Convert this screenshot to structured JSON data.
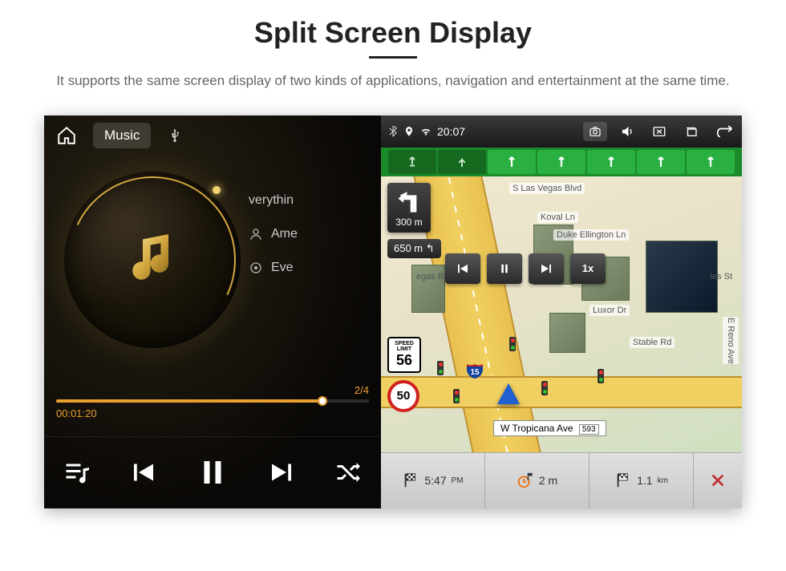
{
  "page": {
    "title": "Split Screen Display",
    "description": "It supports the same screen display of two kinds of applications, navigation and entertainment at the same time."
  },
  "music": {
    "tabs": {
      "music": "Music"
    },
    "track_title_partial": "verythin",
    "artist_partial": "Ame",
    "album_partial": "Eve",
    "counter": "2/4",
    "elapsed": "00:01:20"
  },
  "nav": {
    "status_time": "20:07",
    "turn": {
      "distance": "300 m"
    },
    "next_turn_distance": "650 m",
    "speed_limit": {
      "label_top": "SPEED",
      "label_mid": "LIMIT",
      "value": "56"
    },
    "current_speed": "50",
    "playback_speed": "1x",
    "streets": {
      "las_vegas": "S Las Vegas Blvd",
      "koval": "Koval Ln",
      "duke": "Duke Ellington Ln",
      "luxor": "Luxor Dr",
      "stable": "Stable Rd",
      "reno": "E Reno Ave",
      "tropicana": "W Tropicana Ave",
      "tropicana_badge": "593"
    },
    "interstate": "15",
    "bottom": {
      "arrival_time": "5:47",
      "arrival_unit": "PM",
      "duration": "2 m",
      "distance": "1.1",
      "distance_unit": "km"
    }
  }
}
